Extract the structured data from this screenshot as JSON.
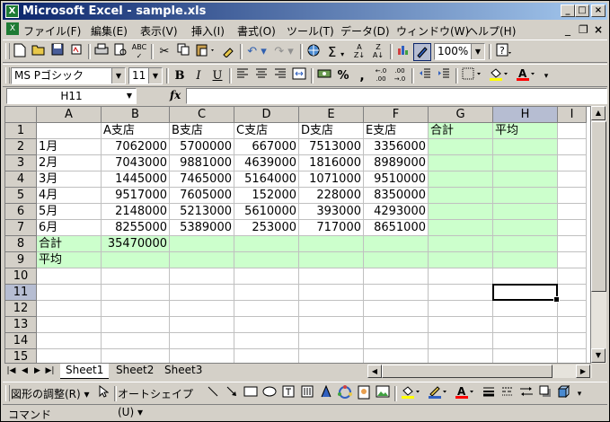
{
  "window": {
    "title": "Microsoft Excel - sample.xls",
    "app_icon": "excel-icon",
    "controls": [
      "_",
      "□",
      "×"
    ]
  },
  "menu": {
    "items": [
      "ファイル(F)",
      "編集(E)",
      "表示(V)",
      "挿入(I)",
      "書式(O)",
      "ツール(T)",
      "データ(D)",
      "ウィンドウ(W)",
      "ヘルプ(H)"
    ],
    "doc_controls": [
      "_",
      "❐",
      "×"
    ]
  },
  "toolbar": {
    "zoom": "100%",
    "font_name": "MS Pゴシック",
    "font_size": "11"
  },
  "formula_bar": {
    "name_box": "H11",
    "fx": "fx",
    "formula": ""
  },
  "sheet": {
    "columns": [
      "A",
      "B",
      "C",
      "D",
      "E",
      "F",
      "G",
      "H",
      "I"
    ],
    "rows": [
      "1",
      "2",
      "3",
      "4",
      "5",
      "6",
      "7",
      "8",
      "9",
      "10",
      "11",
      "12",
      "13",
      "14",
      "15"
    ],
    "cells": [
      [
        "",
        "A支店",
        "B支店",
        "C支店",
        "D支店",
        "E支店",
        "合計",
        "平均",
        ""
      ],
      [
        "1月",
        "7062000",
        "5700000",
        "667000",
        "7513000",
        "3356000",
        "",
        "",
        ""
      ],
      [
        "2月",
        "7043000",
        "9881000",
        "4639000",
        "1816000",
        "8989000",
        "",
        "",
        ""
      ],
      [
        "3月",
        "1445000",
        "7465000",
        "5164000",
        "1071000",
        "9510000",
        "",
        "",
        ""
      ],
      [
        "4月",
        "9517000",
        "7605000",
        "152000",
        "228000",
        "8350000",
        "",
        "",
        ""
      ],
      [
        "5月",
        "2148000",
        "5213000",
        "5610000",
        "393000",
        "4293000",
        "",
        "",
        ""
      ],
      [
        "6月",
        "8255000",
        "5389000",
        "253000",
        "717000",
        "8651000",
        "",
        "",
        ""
      ],
      [
        "合計",
        "35470000",
        "",
        "",
        "",
        "",
        "",
        "",
        ""
      ],
      [
        "平均",
        "",
        "",
        "",
        "",
        "",
        "",
        "",
        ""
      ]
    ],
    "active_cell": "H11",
    "highlight_color": "#ccffcc"
  },
  "tabs": {
    "sheets": [
      "Sheet1",
      "Sheet2",
      "Sheet3"
    ],
    "active": "Sheet1"
  },
  "drawing": {
    "adjust_label": "図形の調整(R)",
    "autoshape_label": "オートシェイプ(U)"
  },
  "status": {
    "text": "コマンド"
  }
}
